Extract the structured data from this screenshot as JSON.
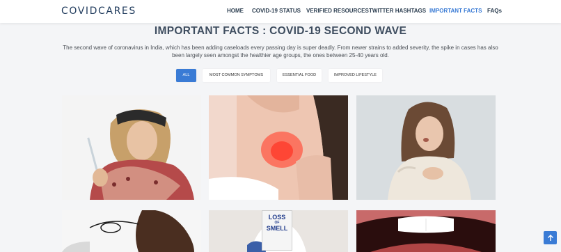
{
  "brand": "COVIDCARES",
  "nav": [
    {
      "label": "HOME",
      "active": false
    },
    {
      "label": "COVID-19 STATUS",
      "active": false
    },
    {
      "label": "VERIFIED RESOURCES",
      "active": false
    },
    {
      "label": "TWITTER HASHTAGS",
      "active": false
    },
    {
      "label": "IMPORTANT FACTS",
      "active": true
    },
    {
      "label": "FAQs",
      "active": false
    }
  ],
  "page_title": "IMPORTANT FACTS : COVID-19 SECOND WAVE",
  "intro": "The second wave of coronavirus in India, which has been adding caseloads every passing day is super deadly. From newer strains to added severity, the spike in cases has also been largely seen amongst the healthier age groups, the ones between 25-40 years old.",
  "filters": [
    {
      "label": "ALL",
      "active": true
    },
    {
      "label": "MOST COMMON SYMPTOMS",
      "active": false
    },
    {
      "label": "ESSENTIAL FOOD",
      "active": false
    },
    {
      "label": "IMPROVED LIFESTYLE",
      "active": false
    }
  ],
  "gallery": [
    {
      "name": "woman-with-thermometer-photo"
    },
    {
      "name": "sore-throat-photo"
    },
    {
      "name": "woman-coughing-photo"
    },
    {
      "name": "man-with-glasses-photo"
    },
    {
      "name": "loss-of-smell-sign-photo",
      "sign_text": [
        "LOSS",
        "OF",
        "SMELL"
      ]
    },
    {
      "name": "open-mouth-tongue-photo"
    }
  ],
  "scroll_top_icon": "arrow-up-icon",
  "colors": {
    "accent": "#3a7bd5",
    "title": "#3e4d5f",
    "nav_text": "#2c3e50",
    "brand": "#1f3a5c"
  }
}
